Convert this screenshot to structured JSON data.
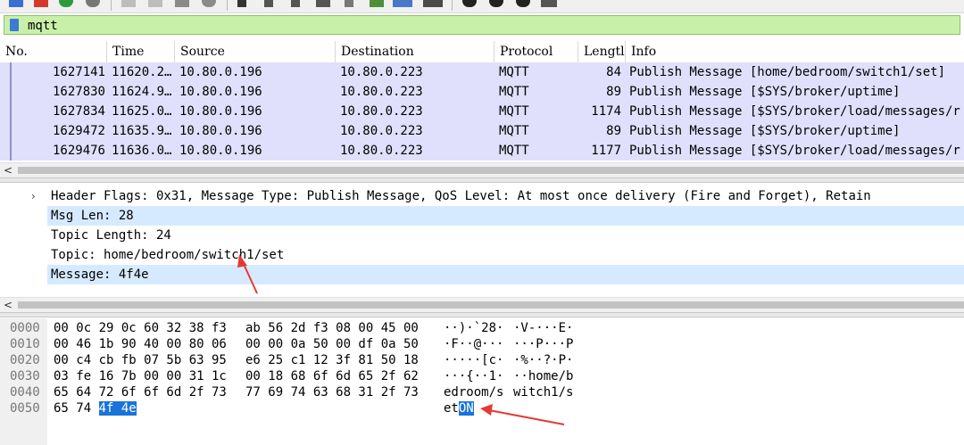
{
  "filter": {
    "text": "mqtt"
  },
  "columns": [
    {
      "label": "No."
    },
    {
      "label": "Time"
    },
    {
      "label": "Source"
    },
    {
      "label": "Destination"
    },
    {
      "label": "Protocol"
    },
    {
      "label": "Lengtl"
    },
    {
      "label": "Info"
    }
  ],
  "packets": [
    {
      "no": "1627141",
      "time": "11620.2…",
      "src": "10.80.0.196",
      "dst": "10.80.0.223",
      "proto": "MQTT",
      "len": "84",
      "info": "Publish Message [home/bedroom/switch1/set]"
    },
    {
      "no": "1627830",
      "time": "11624.9…",
      "src": "10.80.0.196",
      "dst": "10.80.0.223",
      "proto": "MQTT",
      "len": "89",
      "info": "Publish Message [$SYS/broker/uptime]"
    },
    {
      "no": "1627834",
      "time": "11625.0…",
      "src": "10.80.0.196",
      "dst": "10.80.0.223",
      "proto": "MQTT",
      "len": "1174",
      "info": "Publish Message [$SYS/broker/load/messages/r"
    },
    {
      "no": "1629472",
      "time": "11635.9…",
      "src": "10.80.0.196",
      "dst": "10.80.0.223",
      "proto": "MQTT",
      "len": "89",
      "info": "Publish Message [$SYS/broker/uptime]"
    },
    {
      "no": "1629476",
      "time": "11636.0…",
      "src": "10.80.0.196",
      "dst": "10.80.0.223",
      "proto": "MQTT",
      "len": "1177",
      "info": "Publish Message [$SYS/broker/load/messages/r"
    }
  ],
  "details": [
    {
      "text": "Header Flags: 0x31, Message Type: Publish Message, QoS Level: At most once delivery (Fire and Forget), Retain",
      "expander": "›"
    },
    {
      "text": "Msg Len: 28"
    },
    {
      "text": "Topic Length: 24"
    },
    {
      "text": "Topic: home/bedroom/switch1/set"
    },
    {
      "text": "Message: 4f4e"
    }
  ],
  "hex": [
    {
      "off": "0000",
      "h1": "00 0c 29 0c 60 32 38 f3",
      "h2": "ab 56 2d f3 08 00 45 00",
      "a1": "··)·`28·",
      "a2": "·V-···E·"
    },
    {
      "off": "0010",
      "h1": "00 46 1b 90 40 00 80 06",
      "h2": "00 00 0a 50 00 df 0a 50",
      "a1": "·F··@···",
      "a2": "···P···P"
    },
    {
      "off": "0020",
      "h1": "00 c4 cb fb 07 5b 63 95",
      "h2": "e6 25 c1 12 3f 81 50 18",
      "a1": "·····[c·",
      "a2": "·%··?·P·"
    },
    {
      "off": "0030",
      "h1": "03 fe 16 7b 00 00 31 1c",
      "h2": "00 18 68 6f 6d 65 2f 62",
      "a1": "···{··1·",
      "a2": "··home/b"
    },
    {
      "off": "0040",
      "h1": "65 64 72 6f 6f 6d 2f 73",
      "h2": "77 69 74 63 68 31 2f 73",
      "a1": "edroom/s",
      "a2": "witch1/s"
    },
    {
      "off": "0050",
      "h1a": "65 74 ",
      "h1b": "4f 4e",
      "a1a": "et",
      "a1b": "ON"
    }
  ],
  "colors": {
    "filter_bg": "#c8f0a8",
    "row_bg": "#e0e0fc",
    "selected_bg": "#d6eaff",
    "hex_sel": "#1a73d8",
    "annotation": "#e53935"
  },
  "icons": [
    "bookmark-icon",
    "expand-arrow-icon",
    "scroll-left-icon",
    "red-arrow-annotation"
  ]
}
